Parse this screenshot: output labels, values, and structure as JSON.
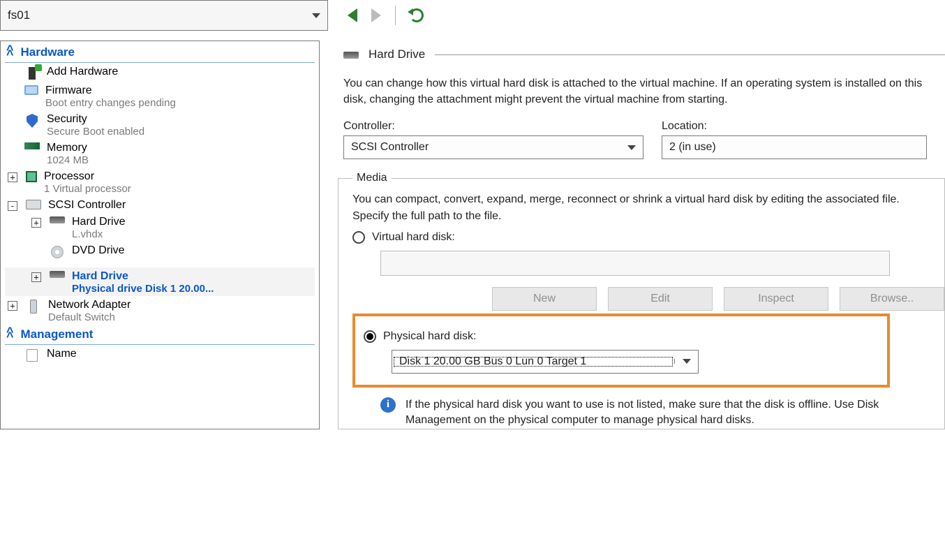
{
  "toolbar": {
    "vm_name": "fs01"
  },
  "sidebar": {
    "hardware_section": "Hardware",
    "management_section": "Management",
    "add_hardware": "Add Hardware",
    "firmware": {
      "label": "Firmware",
      "sub": "Boot entry changes pending"
    },
    "security": {
      "label": "Security",
      "sub": "Secure Boot enabled"
    },
    "memory": {
      "label": "Memory",
      "sub": "1024 MB"
    },
    "processor": {
      "label": "Processor",
      "sub": "1 Virtual processor"
    },
    "scsi": {
      "label": "SCSI Controller"
    },
    "hdd1": {
      "label": "Hard Drive",
      "sub": "L.vhdx"
    },
    "dvd": {
      "label": "DVD Drive"
    },
    "hdd2": {
      "label": "Hard Drive",
      "sub": "Physical drive Disk 1 20.00..."
    },
    "net": {
      "label": "Network Adapter",
      "sub": "Default Switch"
    },
    "name_item": "Name"
  },
  "detail": {
    "title": "Hard Drive",
    "desc": "You can change how this virtual hard disk is attached to the virtual machine. If an operating system is installed on this disk, changing the attachment might prevent the virtual machine from starting.",
    "controller_label": "Controller:",
    "controller_value": "SCSI Controller",
    "location_label": "Location:",
    "location_value": "2 (in use)",
    "media_legend": "Media",
    "media_desc": "You can compact, convert, expand, merge, reconnect or shrink a virtual hard disk by editing the associated file. Specify the full path to the file.",
    "vhd_label": "Virtual hard disk:",
    "btn_new": "New",
    "btn_edit": "Edit",
    "btn_inspect": "Inspect",
    "btn_browse": "Browse..",
    "phys_label": "Physical hard disk:",
    "phys_value": "Disk 1 20.00 GB Bus 0 Lun 0 Target 1",
    "info_msg": "If the physical hard disk you want to use is not listed, make sure that the disk is offline. Use Disk Management on the physical computer to manage physical hard disks."
  }
}
